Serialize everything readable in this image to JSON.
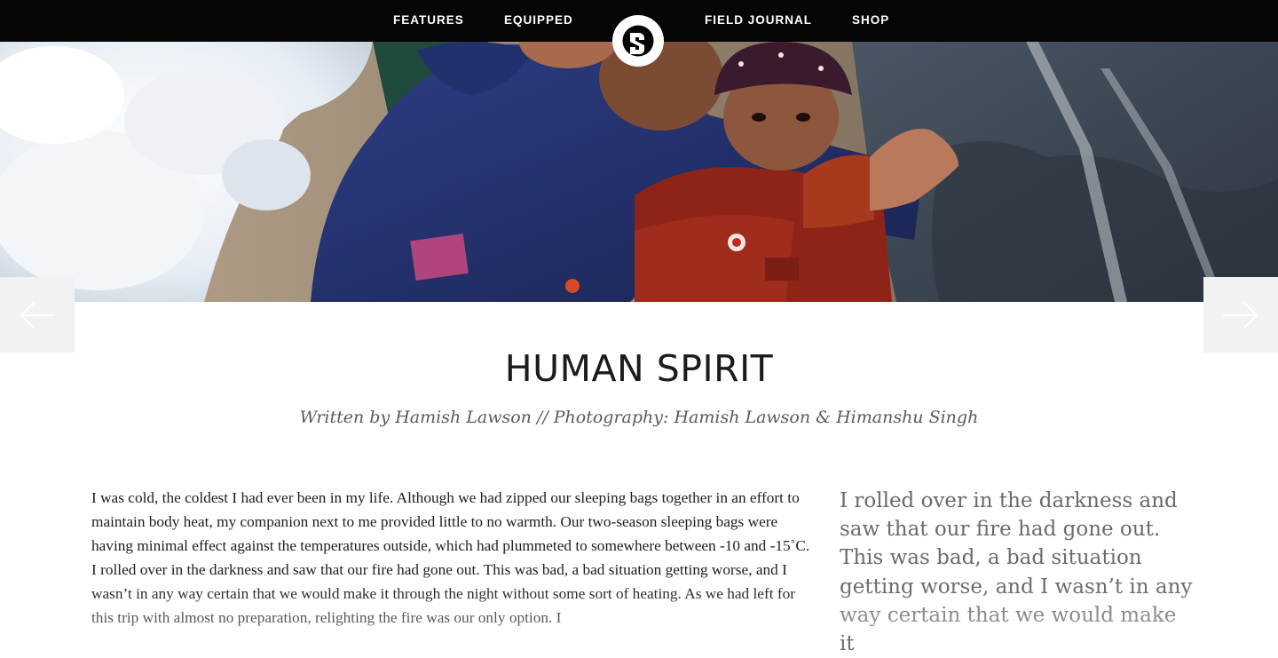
{
  "nav": {
    "items": [
      {
        "label": "FEATURES"
      },
      {
        "label": "EQUIPPED"
      },
      {
        "label": "FIELD JOURNAL"
      },
      {
        "label": "SHOP"
      }
    ],
    "logo_icon": "s-monogram-logo-icon"
  },
  "carousel": {
    "prev_icon": "arrow-left-icon",
    "next_icon": "arrow-right-icon"
  },
  "article": {
    "title": "HUMAN SPIRIT",
    "byline": "Written by Hamish Lawson // Photography: Hamish Lawson & Himanshu Singh",
    "body": "I was cold, the coldest I had ever been in my life. Although we had zipped our sleeping bags together in an effort to maintain body heat, my companion next to me provided little to no warmth. Our two-season sleeping bags were having minimal effect against the temperatures outside, which had plummeted to somewhere between -10 and -15˚C. I rolled over in the darkness and saw that our fire had gone out. This was bad, a bad situation getting worse, and I wasn’t in any way certain that we would make it through the night without some sort of heating. As we had left for this trip with almost no preparation, relighting the fire was our only option. I",
    "pull_quote": "I rolled over in the darkness and saw that our fire had gone out. This was bad, a bad situation getting worse, and I wasn’t in any way certain that we would make it"
  },
  "colors": {
    "nav_bg": "#050505",
    "nav_text": "#ffffff",
    "title": "#1b1b1b",
    "byline": "#5a5a5a",
    "body": "#1e1e1e",
    "pull_quote": "#6b6b6b"
  }
}
